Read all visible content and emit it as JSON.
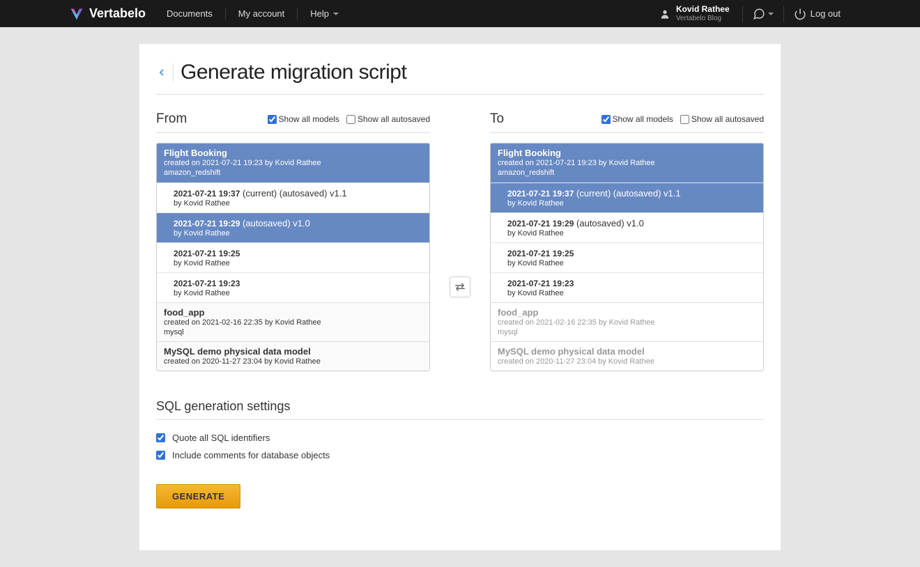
{
  "header": {
    "brand": "Vertabelo",
    "nav": {
      "documents": "Documents",
      "my_account": "My account",
      "help": "Help"
    },
    "user": {
      "name": "Kovid Rathee",
      "sub": "Vertabelo Blog"
    },
    "logout": "Log out"
  },
  "page": {
    "title": "Generate migration script"
  },
  "filters": {
    "show_all_models": "Show all models",
    "show_all_autosaved": "Show all autosaved"
  },
  "from": {
    "title": "From",
    "models_checked": true,
    "autosaved_checked": false,
    "list": [
      {
        "type": "model",
        "selected": true,
        "dim": false,
        "name": "Flight Booking",
        "meta1": "created on 2021-07-21 19:23 by Kovid Rathee",
        "meta2": "amazon_redshift"
      },
      {
        "type": "version",
        "selected": false,
        "date": "2021-07-21 19:37",
        "flags": " (current) (autosaved) v1.1",
        "by": "by Kovid Rathee"
      },
      {
        "type": "version",
        "selected": true,
        "date": "2021-07-21 19:29",
        "flags": " (autosaved) v1.0",
        "by": "by Kovid Rathee"
      },
      {
        "type": "version",
        "selected": false,
        "date": "2021-07-21 19:25",
        "flags": "",
        "by": "by Kovid Rathee"
      },
      {
        "type": "version",
        "selected": false,
        "date": "2021-07-21 19:23",
        "flags": "",
        "by": "by Kovid Rathee"
      },
      {
        "type": "model",
        "selected": false,
        "dim": false,
        "name": "food_app",
        "meta1": "created on 2021-02-16 22:35 by Kovid Rathee",
        "meta2": "mysql"
      },
      {
        "type": "model",
        "selected": false,
        "dim": false,
        "name": "MySQL demo physical data model",
        "meta1": "created on 2020-11-27 23:04 by Kovid Rathee",
        "meta2": ""
      }
    ]
  },
  "to": {
    "title": "To",
    "models_checked": true,
    "autosaved_checked": false,
    "list": [
      {
        "type": "model",
        "selected": true,
        "dim": false,
        "name": "Flight Booking",
        "meta1": "created on 2021-07-21 19:23 by Kovid Rathee",
        "meta2": "amazon_redshift"
      },
      {
        "type": "version",
        "selected": true,
        "date": "2021-07-21 19:37",
        "flags": " (current) (autosaved) v1.1",
        "by": "by Kovid Rathee"
      },
      {
        "type": "version",
        "selected": false,
        "date": "2021-07-21 19:29",
        "flags": " (autosaved) v1.0",
        "by": "by Kovid Rathee"
      },
      {
        "type": "version",
        "selected": false,
        "date": "2021-07-21 19:25",
        "flags": "",
        "by": "by Kovid Rathee"
      },
      {
        "type": "version",
        "selected": false,
        "date": "2021-07-21 19:23",
        "flags": "",
        "by": "by Kovid Rathee"
      },
      {
        "type": "model",
        "selected": false,
        "dim": true,
        "name": "food_app",
        "meta1": "created on 2021-02-16 22:35 by Kovid Rathee",
        "meta2": "mysql"
      },
      {
        "type": "model",
        "selected": false,
        "dim": true,
        "name": "MySQL demo physical data model",
        "meta1": "created on 2020-11-27 23:04 by Kovid Rathee",
        "meta2": ""
      }
    ]
  },
  "settings": {
    "title": "SQL generation settings",
    "quote_ids": "Quote all SQL identifiers",
    "include_comments": "Include comments for database objects",
    "quote_checked": true,
    "comments_checked": true
  },
  "generate_label": "GENERATE"
}
